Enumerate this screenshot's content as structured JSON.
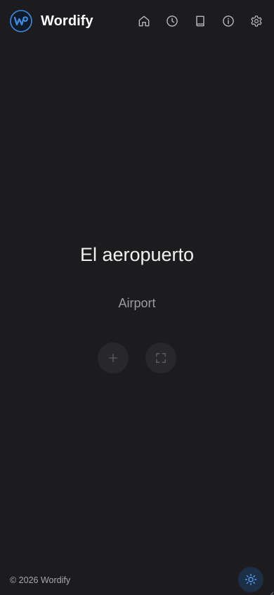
{
  "header": {
    "app_name": "Wordify",
    "logo_icon": "wordify-logo-icon",
    "nav": [
      {
        "name": "home",
        "icon": "home-icon"
      },
      {
        "name": "history",
        "icon": "clock-icon"
      },
      {
        "name": "dictionary",
        "icon": "book-icon"
      },
      {
        "name": "info",
        "icon": "info-icon"
      },
      {
        "name": "settings",
        "icon": "gear-icon"
      }
    ]
  },
  "card": {
    "word": "El aeropuerto",
    "translation": "Airport",
    "actions": [
      {
        "name": "add",
        "icon": "plus-icon"
      },
      {
        "name": "fullscreen",
        "icon": "fullscreen-icon"
      }
    ]
  },
  "footer": {
    "copyright": "© 2026 Wordify",
    "theme_toggle_icon": "sun-icon"
  },
  "colors": {
    "background": "#1c1c1e",
    "accent": "#3d8be0",
    "muted_text": "#9a9ca2",
    "button_bg": "#28282b"
  }
}
